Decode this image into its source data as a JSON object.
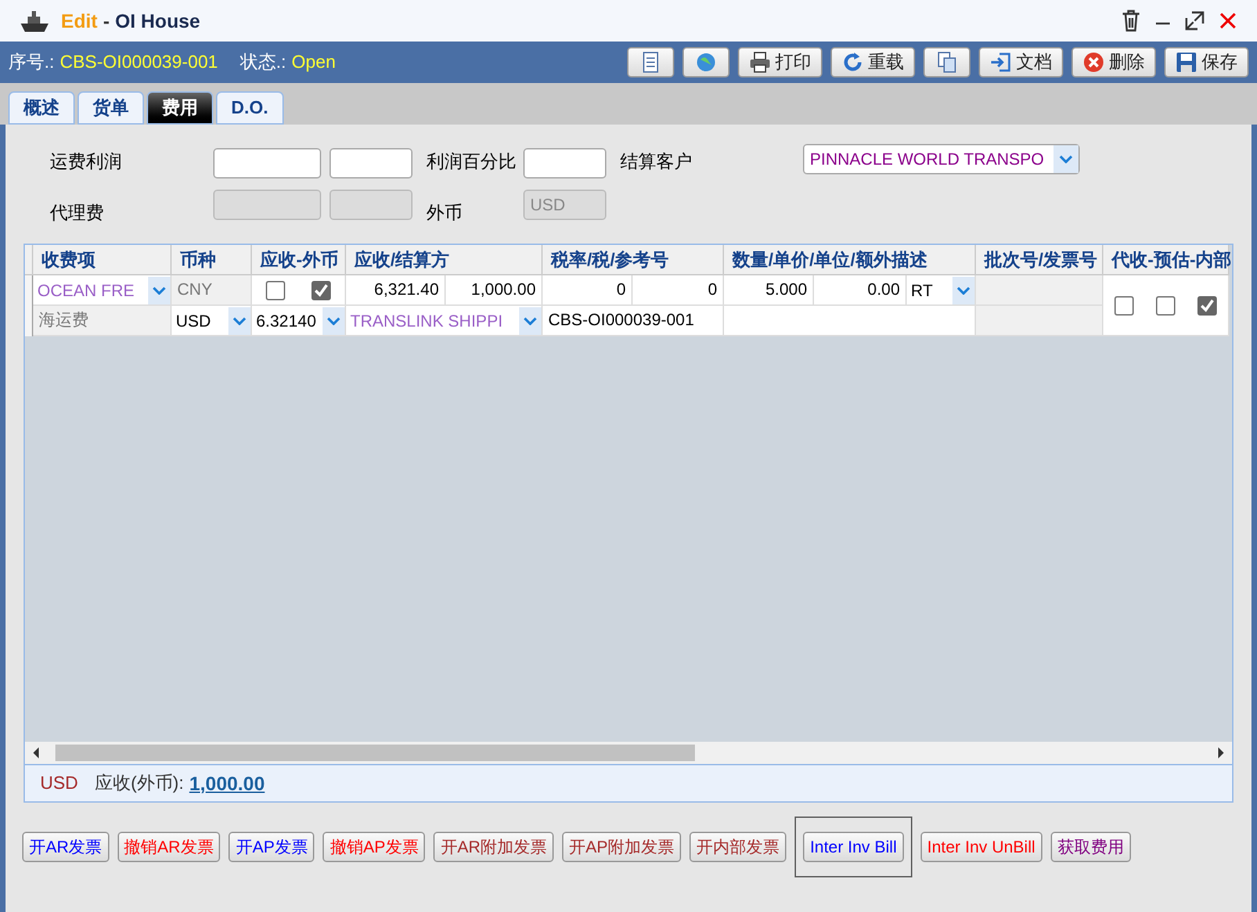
{
  "window": {
    "mode": "Edit",
    "separator": "-",
    "title": "OI House"
  },
  "info": {
    "serial_label": "序号.:",
    "serial": "CBS-OI000039-001",
    "status_label": "状态.:",
    "status": "Open"
  },
  "toolbar": [
    {
      "kind": "icon"
    },
    {
      "kind": "icon"
    },
    {
      "kind": "text",
      "label": "打印"
    },
    {
      "kind": "text",
      "label": "重载"
    },
    {
      "kind": "icon"
    },
    {
      "kind": "text",
      "label": "文档"
    },
    {
      "kind": "text",
      "label": "删除"
    },
    {
      "kind": "text",
      "label": "保存"
    }
  ],
  "tabs": [
    {
      "label": "概述",
      "selected": false
    },
    {
      "label": "货单",
      "selected": false
    },
    {
      "label": "费用",
      "selected": true
    },
    {
      "label": "D.O.",
      "selected": false
    }
  ],
  "form": {
    "freight_profit_label": "运费利润",
    "agency_fee_label": "代理费",
    "profit_percent_label": "利润百分比",
    "foreign_currency_label": "外币",
    "foreign_currency": "USD",
    "settle_customer_label": "结算客户",
    "settle_customer": "PINNACLE WORLD TRANSPO"
  },
  "table": {
    "columns": [
      "收费项",
      "币种",
      "应收-外币",
      "应收/结算方",
      "税率/税/参考号",
      "数量/单价/单位/额外描述",
      "批次号/发票号",
      "代收-预估-内部"
    ],
    "rows": [
      {
        "cells": [
          {
            "kind": "select",
            "value": "OCEAN FRE"
          },
          {
            "kind": "readonly",
            "value": "CNY"
          },
          {
            "kind": "checks",
            "checks": [
              false,
              true
            ]
          },
          {
            "kind": "group",
            "parts": [
              {
                "kind": "number",
                "value": "6,321.40"
              },
              {
                "kind": "number",
                "value": "1,000.00"
              }
            ]
          },
          {
            "kind": "group",
            "parts": [
              {
                "kind": "number",
                "value": "0"
              },
              {
                "kind": "number",
                "value": "0"
              }
            ]
          },
          {
            "kind": "group",
            "parts": [
              {
                "kind": "number",
                "value": "5.000"
              },
              {
                "kind": "number",
                "value": "0.00"
              },
              {
                "kind": "select",
                "value": "RT"
              }
            ]
          },
          {
            "kind": "blank"
          },
          {
            "kind": "checks",
            "checks": [
              false,
              false,
              true
            ]
          }
        ]
      },
      {
        "cells": [
          {
            "kind": "readonly",
            "value": "海运费"
          },
          {
            "kind": "select",
            "value": "USD"
          },
          {
            "kind": "select",
            "value": "6.32140"
          },
          {
            "kind": "select",
            "value": "TRANSLINK SHIPPI"
          },
          {
            "kind": "text",
            "value": "CBS-OI000039-001"
          },
          {
            "kind": "empty"
          },
          {
            "kind": "blank"
          }
        ]
      }
    ]
  },
  "summary": {
    "currency": "USD",
    "label": "应收(外币):",
    "amount": "1,000.00"
  },
  "actions": [
    {
      "label": "开AR发票",
      "color": "#0000ff",
      "selected": false
    },
    {
      "label": "撤销AR发票",
      "color": "#ff0000",
      "selected": false
    },
    {
      "label": "开AP发票",
      "color": "#0000ff",
      "selected": false
    },
    {
      "label": "撤销AP发票",
      "color": "#ff0000",
      "selected": false
    },
    {
      "label": "开AR附加发票",
      "color": "#a52a2a",
      "selected": false
    },
    {
      "label": "开AP附加发票",
      "color": "#a52a2a",
      "selected": false
    },
    {
      "label": "开内部发票",
      "color": "#a52a2a",
      "selected": false
    },
    {
      "label": "Inter Inv Bill",
      "color": "#0000ff",
      "selected": true
    },
    {
      "label": "Inter Inv UnBill",
      "color": "#ff0000",
      "selected": false
    },
    {
      "label": "获取费用",
      "color": "#800080",
      "selected": false
    }
  ]
}
